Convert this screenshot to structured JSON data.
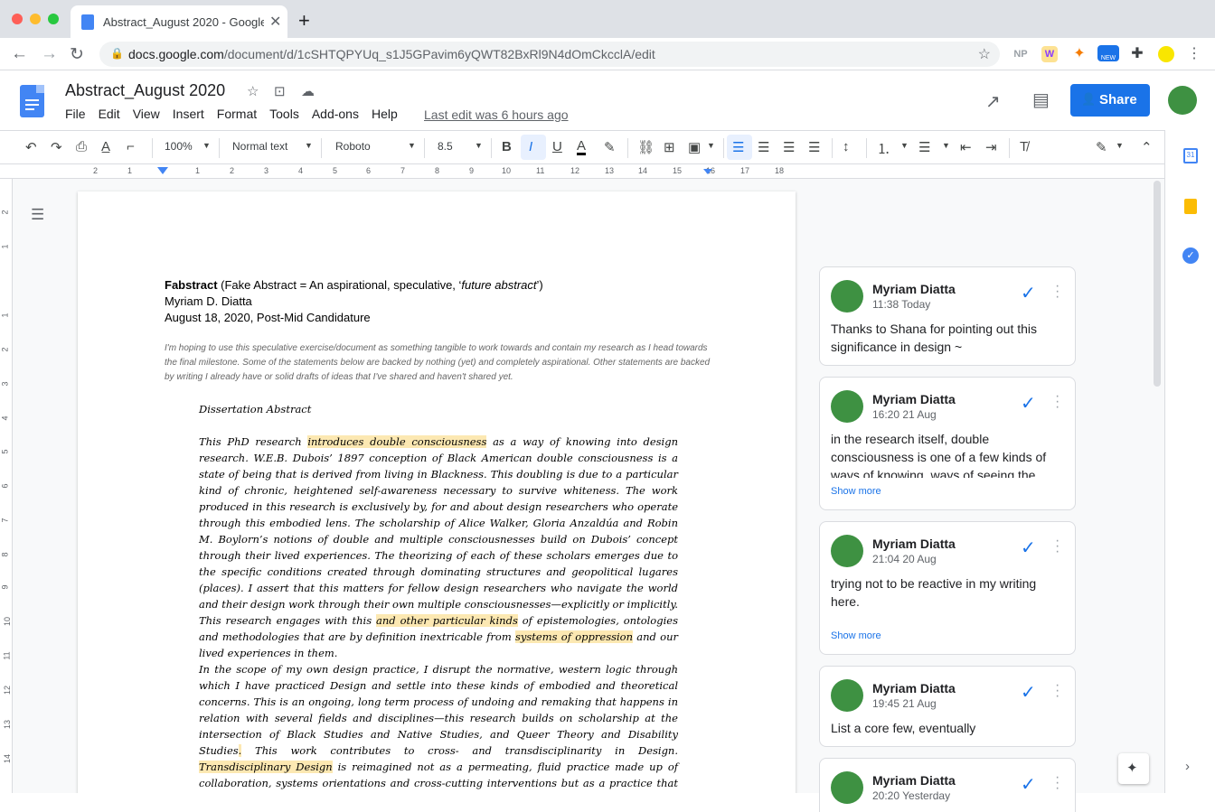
{
  "browser": {
    "tab_title": "Abstract_August 2020 - Google Docs",
    "new_tab": "+",
    "url_host": "docs.google.com",
    "url_path": "/document/d/1cSHTQPYUq_s1J5GPavim6yQWT82BxRl9N4dOmCkcclA/edit",
    "ext_np": "NP",
    "ext_new_badge": "NEW"
  },
  "doc": {
    "title": "Abstract_August 2020",
    "menu": [
      "File",
      "Edit",
      "View",
      "Insert",
      "Format",
      "Tools",
      "Add-ons",
      "Help"
    ],
    "last_edit": "Last edit was 6 hours ago",
    "share_label": "Share"
  },
  "toolbar": {
    "zoom": "100%",
    "style": "Normal text",
    "font": "Roboto",
    "size": "8.5"
  },
  "ruler": {
    "h_ticks": [
      "2",
      "1",
      "1",
      "2",
      "3",
      "4",
      "5",
      "6",
      "7",
      "8",
      "9",
      "10",
      "11",
      "12",
      "13",
      "14",
      "15",
      "16",
      "17",
      "18"
    ],
    "v_ticks": [
      "2",
      "1",
      "1",
      "2",
      "3",
      "4",
      "5",
      "6",
      "7",
      "8",
      "9",
      "10",
      "11",
      "12",
      "13",
      "14"
    ]
  },
  "content": {
    "header_bold": "Fabstract",
    "header_rest": " (Fake Abstract = An aspirational, speculative, ‘",
    "header_italic": "future abstract",
    "header_end": "’)",
    "author": "Myriam D. Diatta",
    "date": "August 18, 2020, Post-Mid Candidature",
    "intro": "I'm hoping to use this speculative exercise/document as something tangible to work towards and contain my research as I head towards the final milestone. Some of the statements below are backed by nothing (yet) and completely aspirational. Other statements are backed by writing I already have or solid drafts of ideas that I've shared and haven't shared yet.",
    "diss_title": "Dissertation Abstract",
    "p1_a": "This PhD research ",
    "p1_hl1": "introduces double consciousness",
    "p1_b": " as a way of knowing into design research. W.E.B. Dubois’ 1897 conception of Black American double consciousness is a state of being that is derived from living in Blackness. This doubling is due to a particular kind of chronic, heightened self-awareness necessary to survive whiteness. The work produced in this research is exclusively by, for and about design researchers who operate through this embodied lens. The scholarship of Alice Walker, Gloria Anzaldúa and Robin M. Boylorn’s notions of double and multiple consciousnesses build on Dubois’ concept through their lived experiences. The theorizing of each of these scholars emerges due to the specific conditions created through dominating structures and geopolitical lugares (places). I assert that this matters for fellow design researchers who navigate the world and their design work through their own multiple consciousnesses—explicitly or implicitly. This research engages with this ",
    "p1_hl2": "and other particular kinds",
    "p1_c": " of epistemologies, ontologies and methodologies that are by definition inextricable from ",
    "p1_hl3": "systems of oppression",
    "p1_d": " and our lived experiences in them.",
    "p2_a": "In the scope of my own design practice, I disrupt the normative, western logic through which I have practiced Design and settle into these kinds of embodied and theoretical concerns. This is an ongoing, long term process of undoing and remaking that happens in relation with several fields and disciplines—this research builds on scholarship at the intersection of Black Studies and Native Studies, and Queer Theory and Disability Studies",
    "p2_hl1": ".",
    "p2_b": " This work contributes to cross- and transdisciplinarity in Design. ",
    "p2_hl2": "Transdisciplinary Design",
    "p2_c": " is reimagined not as a permeating, fluid practice made up of collaboration, systems orientations and cross-cutting interventions but as a practice that begins and ends with its 'between' state. I repurpose the distinct position of being"
  },
  "comments": [
    {
      "name": "Myriam Diatta",
      "time": "11:38 Today",
      "body": "Thanks to Shana for pointing out this significance in design ~",
      "show_more": ""
    },
    {
      "name": "Myriam Diatta",
      "time": "16:20 21 Aug",
      "body": "in the research itself, double consciousness is one of a few kinds of ways of knowing, ways of seeing the",
      "show_more": "Show more"
    },
    {
      "name": "Myriam Diatta",
      "time": "21:04 20 Aug",
      "body": "trying not to be reactive in my writing here.",
      "show_more": "Show more"
    },
    {
      "name": "Myriam Diatta",
      "time": "19:45 21 Aug",
      "body": "List a core few, eventually",
      "show_more": ""
    },
    {
      "name": "Myriam Diatta",
      "time": "20:20 Yesterday",
      "body": "",
      "show_more": ""
    }
  ]
}
